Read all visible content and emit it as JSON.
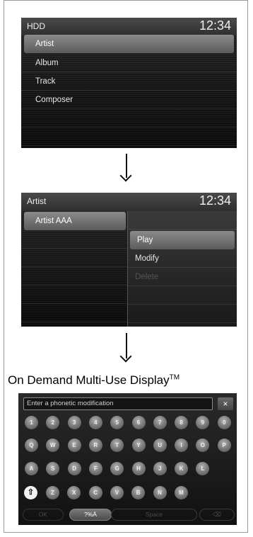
{
  "screen1": {
    "title": "HDD",
    "clock": "12:34",
    "items": [
      "Artist",
      "Album",
      "Track",
      "Composer"
    ]
  },
  "screen2": {
    "title": "Artist",
    "clock": "12:34",
    "list_items": [
      "Artist AAA"
    ],
    "menu_items": [
      "Play",
      "Modify",
      "Delete"
    ]
  },
  "caption": {
    "text": "On Demand Multi-Use Display",
    "tm": "TM"
  },
  "keyboard": {
    "placeholder": "Enter a phonetic modification",
    "close_label": "×",
    "rows": [
      [
        "1",
        "2",
        "3",
        "4",
        "5",
        "6",
        "7",
        "8",
        "9",
        "0"
      ],
      [
        "Q",
        "W",
        "E",
        "R",
        "T",
        "Y",
        "U",
        "I",
        "O",
        "P"
      ],
      [
        "A",
        "S",
        "D",
        "F",
        "G",
        "H",
        "J",
        "K",
        "L"
      ],
      [
        "Z",
        "X",
        "C",
        "V",
        "B",
        "N",
        "M"
      ]
    ],
    "shift_icon": "⇧",
    "ok_label": "OK",
    "symbols_label": "?%Ä",
    "space_label": "Space",
    "backspace_icon": "⌫"
  }
}
